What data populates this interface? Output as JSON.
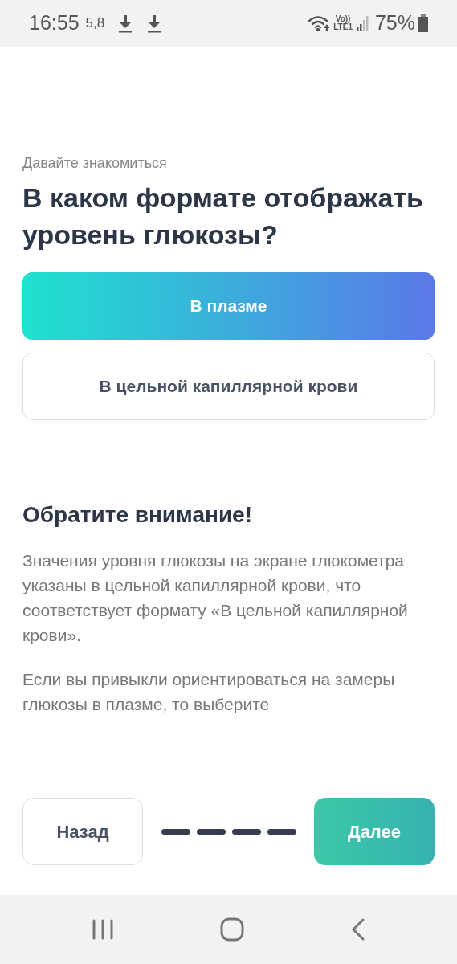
{
  "status_bar": {
    "time": "16:55",
    "speed": "5,8",
    "volte": "Vo))",
    "network": "LTE1",
    "battery": "75%"
  },
  "subtitle": "Давайте знакомиться",
  "title": "В каком формате отображать уровень глюкозы?",
  "options": [
    {
      "label": "В плазме",
      "selected": true
    },
    {
      "label": "В цельной капиллярной крови",
      "selected": false
    }
  ],
  "notice": {
    "heading": "Обратите внимание!",
    "paragraphs": [
      "Значения уровня глюкозы на экране глюкометра указаны в цельной капиллярной крови, что соответствует формату «В цельной капиллярной крови».",
      "Если вы привыкли ориентироваться на замеры глюкозы в плазме, то выберите"
    ]
  },
  "footer": {
    "back": "Назад",
    "next": "Далее",
    "steps": [
      {
        "done": true
      },
      {
        "done": true
      },
      {
        "done": true
      },
      {
        "done": true
      }
    ]
  }
}
